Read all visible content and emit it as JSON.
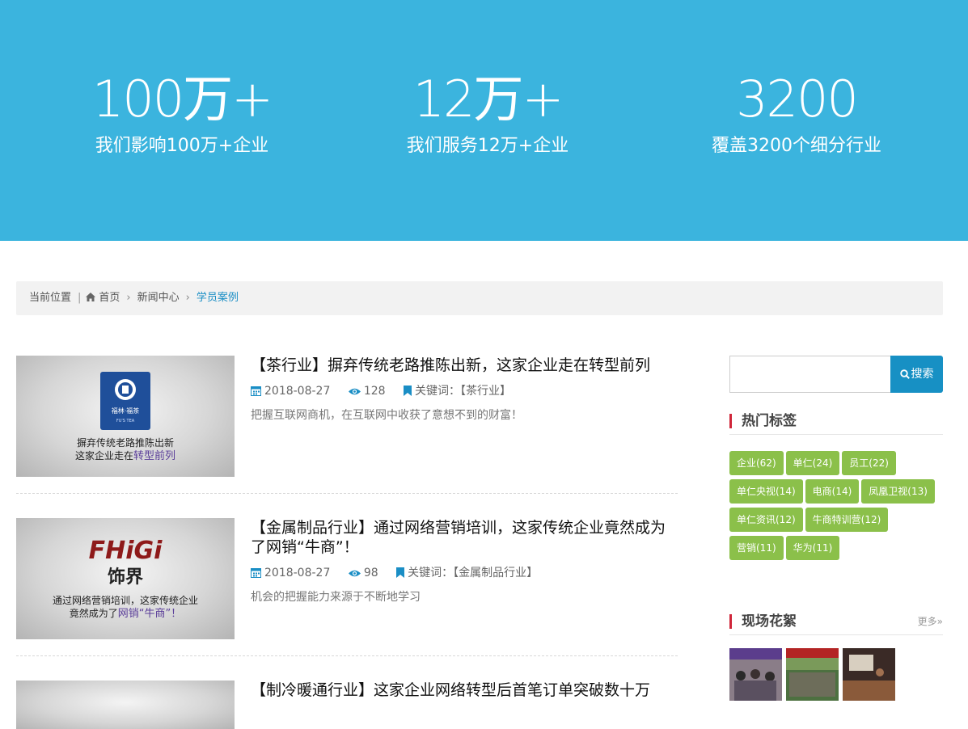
{
  "stats": [
    {
      "num": "100万+",
      "desc": "我们影响100万+企业"
    },
    {
      "num": "12万+",
      "desc": "我们服务12万+企业"
    },
    {
      "num": "3200",
      "desc": "覆盖3200个细分行业"
    }
  ],
  "breadcrumb": {
    "prefix": "当前位置",
    "items": [
      "首页",
      "新闻中心",
      "学员案例"
    ]
  },
  "articles": [
    {
      "title": "【茶行业】摒弃传统老路推陈出新，这家企业走在转型前列",
      "date": "2018-08-27",
      "views": "128",
      "keywords_label": "关键词：",
      "keywords": "【茶行业】",
      "summary": "把握互联网商机，在互联网中收获了意想不到的财富！",
      "thumb": {
        "brand": "福林·福茶",
        "line1": "摒弃传统老路推陈出新",
        "line2a": "这家企业走在",
        "line2b": "转型前列"
      }
    },
    {
      "title": "【金属制品行业】通过网络营销培训，这家传统企业竟然成为了网销“牛商”！",
      "date": "2018-08-27",
      "views": "98",
      "keywords_label": "关键词：",
      "keywords": "【金属制品行业】",
      "summary": "机会的把握能力来源于不断地学习",
      "thumb": {
        "brand": "FHiGi",
        "brand2": "饰界",
        "line1": "通过网络营销培训，这家传统企业",
        "line2a": "竟然成为了",
        "line2b": "网销“牛商”！"
      }
    },
    {
      "title": "【制冷暖通行业】这家企业网络转型后首笔订单突破数十万"
    }
  ],
  "sidebar": {
    "search_button": "搜索",
    "hot_tags_title": "热门标签",
    "tags": [
      "企业(62)",
      "单仁(24)",
      "员工(22)",
      "单仁央视(14)",
      "电商(14)",
      "凤凰卫视(13)",
      "单仁资讯(12)",
      "牛商特训营(12)",
      "营销(11)",
      "华为(11)"
    ],
    "photos_title": "现场花絮",
    "more": "更多»"
  },
  "colors": {
    "banner": "#3bb4de",
    "accent_blue": "#1790c4",
    "tag_green": "#8bc04a",
    "section_red": "#d0263a"
  }
}
